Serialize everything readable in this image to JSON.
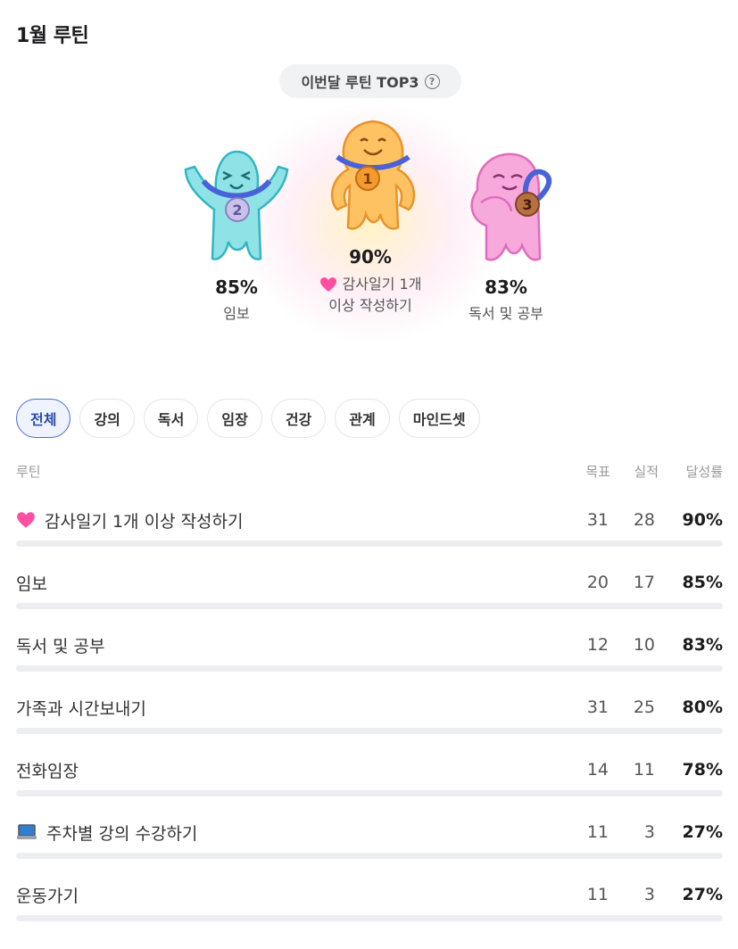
{
  "title": "1월 루틴",
  "top3": {
    "label": "이번달 루틴 TOP3",
    "help_glyph": "?",
    "first": {
      "rank": "1",
      "percent": "90%",
      "name_line1": "감사일기 1개",
      "name_line2": "이상 작성하기",
      "icon": "heart-icon"
    },
    "second": {
      "rank": "2",
      "percent": "85%",
      "name": "임보"
    },
    "third": {
      "rank": "3",
      "percent": "83%",
      "name": "독서 및 공부"
    }
  },
  "tabs": [
    "전체",
    "강의",
    "독서",
    "임장",
    "건강",
    "관계",
    "마인드셋"
  ],
  "active_tab": "전체",
  "table": {
    "headers": {
      "routine": "루틴",
      "goal": "목표",
      "actual": "실적",
      "rate": "달성률"
    },
    "rows": [
      {
        "icon": "heart-icon",
        "name": "감사일기 1개 이상 작성하기",
        "goal": "31",
        "actual": "28",
        "rate": "90%"
      },
      {
        "icon": "",
        "name": "임보",
        "goal": "20",
        "actual": "17",
        "rate": "85%"
      },
      {
        "icon": "",
        "name": "독서 및 공부",
        "goal": "12",
        "actual": "10",
        "rate": "83%"
      },
      {
        "icon": "",
        "name": "가족과 시간보내기",
        "goal": "31",
        "actual": "25",
        "rate": "80%"
      },
      {
        "icon": "",
        "name": "전화임장",
        "goal": "14",
        "actual": "11",
        "rate": "78%"
      },
      {
        "icon": "laptop-icon",
        "name": "주차별 강의 수강하기",
        "goal": "11",
        "actual": "3",
        "rate": "27%"
      },
      {
        "icon": "",
        "name": "운동가기",
        "goal": "11",
        "actual": "3",
        "rate": "27%"
      }
    ]
  },
  "colors": {
    "accent": "#4a6fd3",
    "gold_mascot": "#ffbe55",
    "silver_mascot": "#7fdde0",
    "bronze_mascot": "#f6a3d8",
    "heart": "#ff4fa0"
  }
}
